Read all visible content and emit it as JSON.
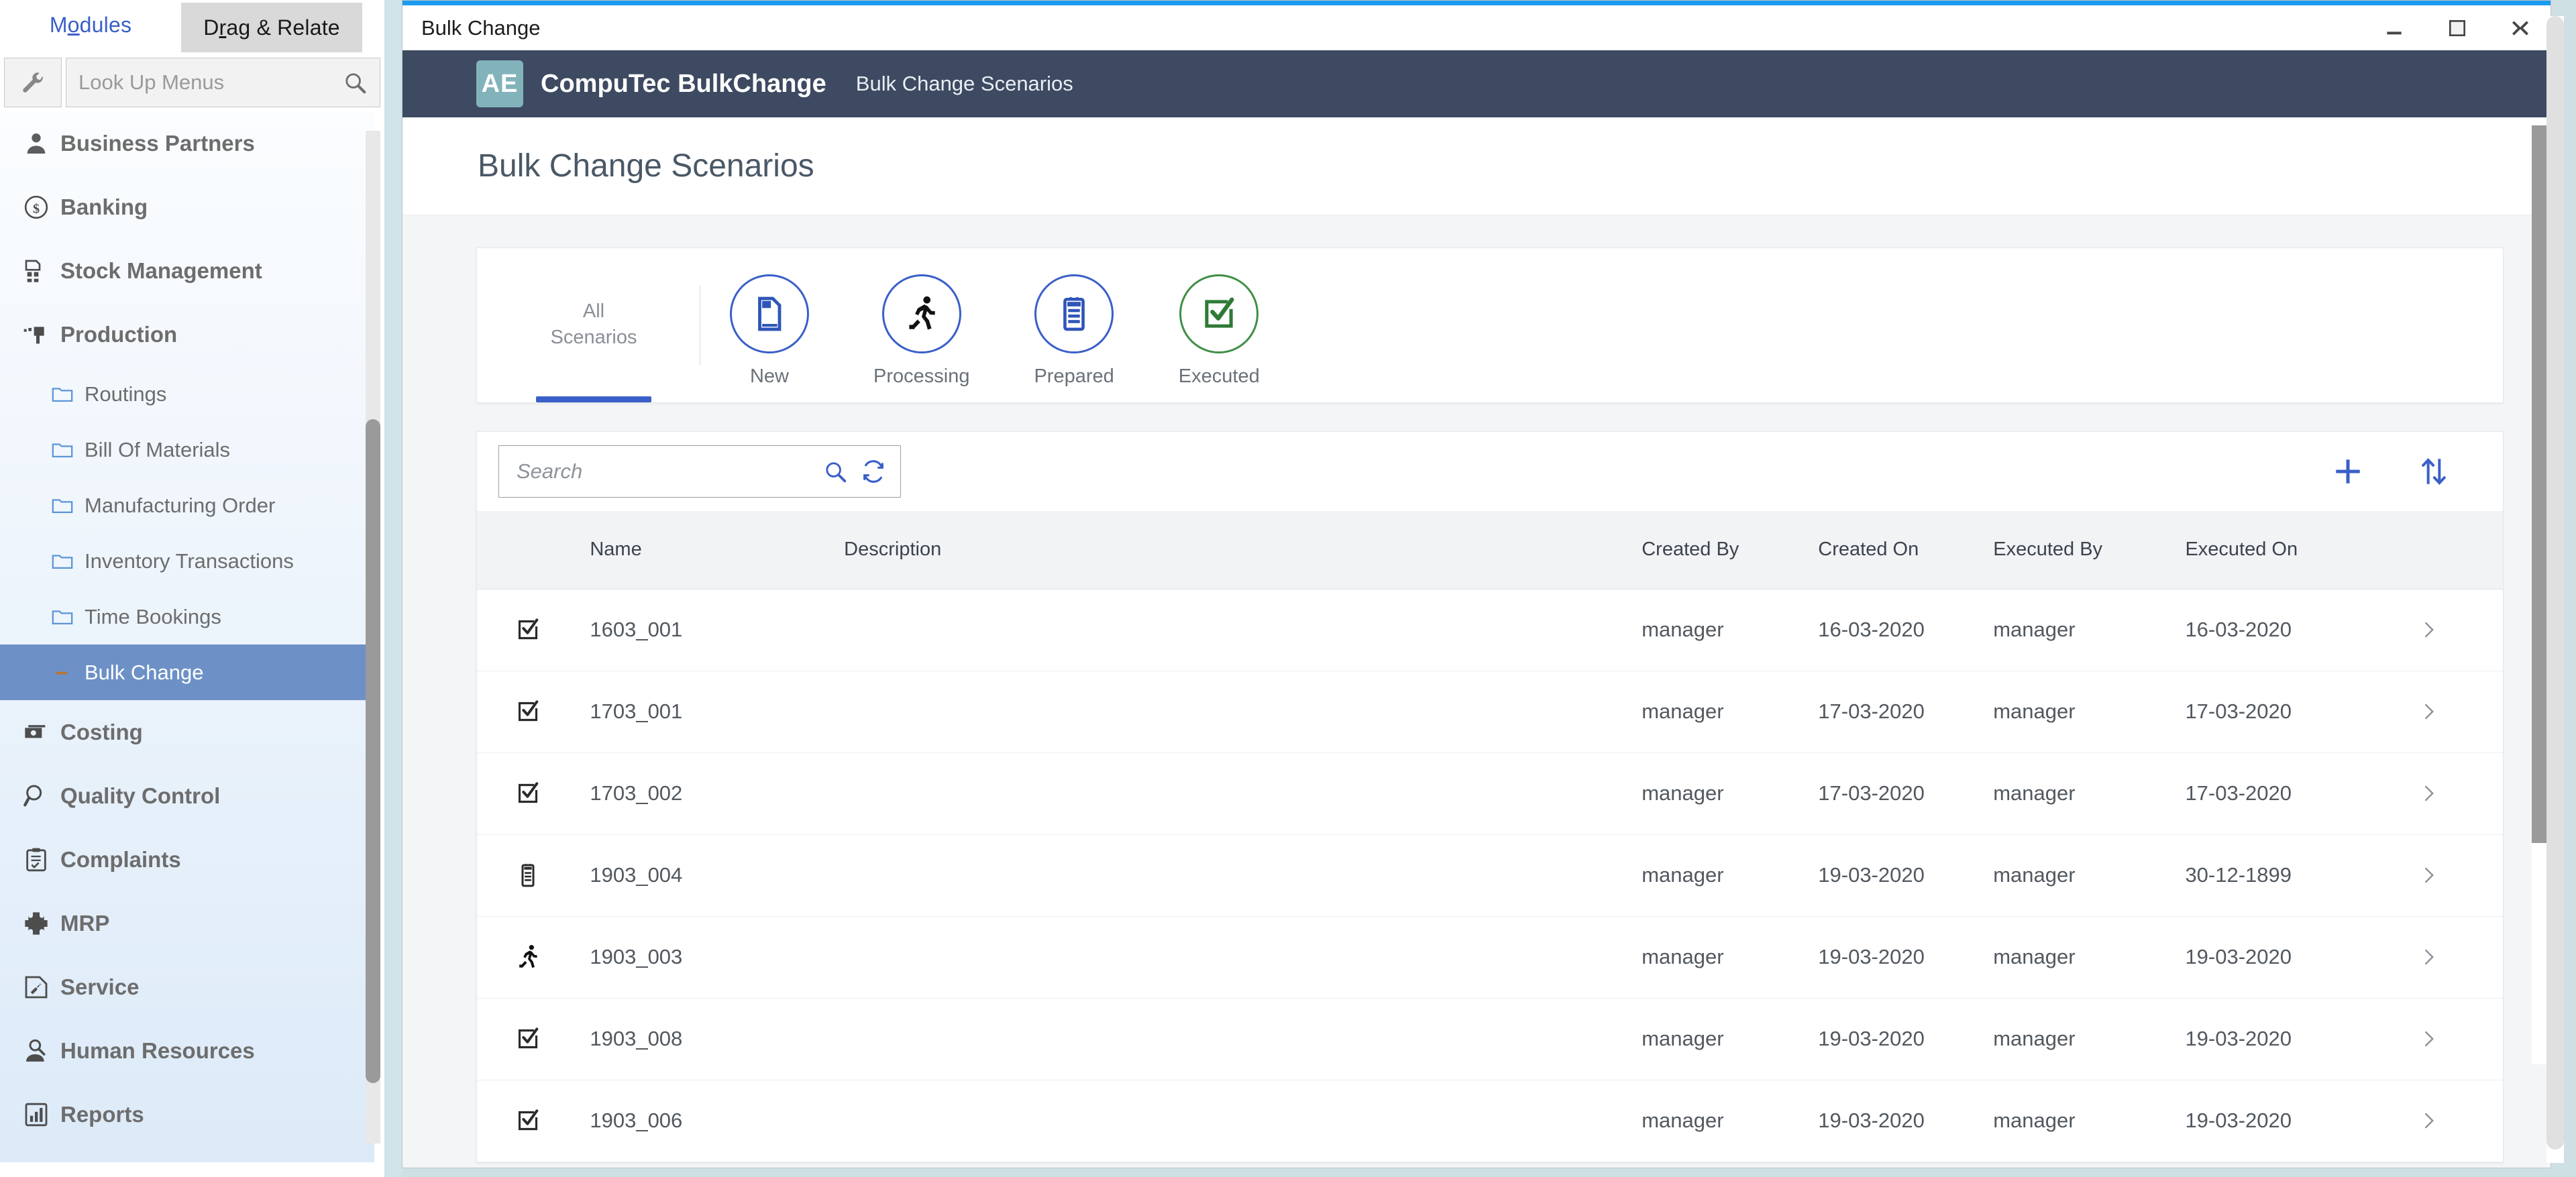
{
  "shell": {
    "tabs": [
      {
        "label": "Modules",
        "underline_char": "o",
        "active": true
      },
      {
        "label": "Drag & Relate",
        "underline_char": "r",
        "active": false
      }
    ],
    "lookup": {
      "placeholder": "Look Up Menus"
    },
    "nav": [
      {
        "label": "Business Partners",
        "icon": "person-icon",
        "level": "top"
      },
      {
        "label": "Banking",
        "icon": "dollar-circle-icon",
        "level": "top"
      },
      {
        "label": "Stock Management",
        "icon": "stock-icon",
        "level": "top"
      },
      {
        "label": "Production",
        "icon": "production-icon",
        "level": "top"
      },
      {
        "label": "Routings",
        "icon": "folder-icon",
        "level": "sub"
      },
      {
        "label": "Bill Of Materials",
        "icon": "folder-icon",
        "level": "sub"
      },
      {
        "label": "Manufacturing Order",
        "icon": "folder-icon",
        "level": "sub"
      },
      {
        "label": "Inventory Transactions",
        "icon": "folder-icon",
        "level": "sub"
      },
      {
        "label": "Time Bookings",
        "icon": "folder-icon",
        "level": "sub"
      },
      {
        "label": "Bulk Change",
        "icon": "dash-icon",
        "level": "sub",
        "active": true
      },
      {
        "label": "Costing",
        "icon": "money-icon",
        "level": "top"
      },
      {
        "label": "Quality Control",
        "icon": "magnifier-icon",
        "level": "top"
      },
      {
        "label": "Complaints",
        "icon": "clipboard-check-icon",
        "level": "top"
      },
      {
        "label": "MRP",
        "icon": "puzzle-icon",
        "level": "top"
      },
      {
        "label": "Service",
        "icon": "service-icon",
        "level": "top"
      },
      {
        "label": "Human Resources",
        "icon": "person-search-icon",
        "level": "top"
      },
      {
        "label": "Reports",
        "icon": "bar-chart-icon",
        "level": "top"
      }
    ]
  },
  "window": {
    "title": "Bulk Change",
    "minimize_label": "–",
    "maximize_label": "☐",
    "close_label": "✕"
  },
  "app": {
    "logo_text": "AE",
    "brand": "CompuTec BulkChange",
    "breadcrumb": "Bulk Change Scenarios",
    "page_title": "Bulk Change Scenarios"
  },
  "scenario_tabs": [
    {
      "label": "All",
      "label2": "Scenarios",
      "icon": "none",
      "active": true,
      "color": "#3a5fc8"
    },
    {
      "label": "New",
      "icon": "document-icon",
      "active": false,
      "color": "#3a5fc8"
    },
    {
      "label": "Processing",
      "icon": "running-person-icon",
      "active": false,
      "color": "#3a5fc8"
    },
    {
      "label": "Prepared",
      "icon": "clipboard-list-icon",
      "active": false,
      "color": "#3a5fc8"
    },
    {
      "label": "Executed",
      "icon": "check-box-icon",
      "active": false,
      "color": "#3f8f46"
    }
  ],
  "toolbar": {
    "search_placeholder": "Search",
    "search_value": "",
    "search_icon": "search-icon",
    "refresh_icon": "refresh-icon",
    "add_icon": "plus-icon",
    "sort_icon": "sort-arrows-icon"
  },
  "table": {
    "columns": [
      {
        "key": "status",
        "label": ""
      },
      {
        "key": "name",
        "label": "Name"
      },
      {
        "key": "description",
        "label": "Description"
      },
      {
        "key": "created_by",
        "label": "Created By"
      },
      {
        "key": "created_on",
        "label": "Created On"
      },
      {
        "key": "executed_by",
        "label": "Executed By"
      },
      {
        "key": "executed_on",
        "label": "Executed On"
      },
      {
        "key": "chevron",
        "label": ""
      }
    ],
    "rows": [
      {
        "status_icon": "check-box-icon",
        "name": "1603_001",
        "description": "",
        "created_by": "manager",
        "created_on": "16-03-2020",
        "executed_by": "manager",
        "executed_on": "16-03-2020"
      },
      {
        "status_icon": "check-box-icon",
        "name": "1703_001",
        "description": "",
        "created_by": "manager",
        "created_on": "17-03-2020",
        "executed_by": "manager",
        "executed_on": "17-03-2020"
      },
      {
        "status_icon": "check-box-icon",
        "name": "1703_002",
        "description": "",
        "created_by": "manager",
        "created_on": "17-03-2020",
        "executed_by": "manager",
        "executed_on": "17-03-2020"
      },
      {
        "status_icon": "clipboard-list-icon",
        "name": "1903_004",
        "description": "",
        "created_by": "manager",
        "created_on": "19-03-2020",
        "executed_by": "manager",
        "executed_on": "30-12-1899"
      },
      {
        "status_icon": "running-person-icon",
        "name": "1903_003",
        "description": "",
        "created_by": "manager",
        "created_on": "19-03-2020",
        "executed_by": "manager",
        "executed_on": "19-03-2020"
      },
      {
        "status_icon": "check-box-icon",
        "name": "1903_008",
        "description": "",
        "created_by": "manager",
        "created_on": "19-03-2020",
        "executed_by": "manager",
        "executed_on": "19-03-2020"
      },
      {
        "status_icon": "check-box-icon",
        "name": "1903_006",
        "description": "",
        "created_by": "manager",
        "created_on": "19-03-2020",
        "executed_by": "manager",
        "executed_on": "19-03-2020"
      }
    ]
  },
  "colors": {
    "header_bg": "#3d4a61",
    "logo_bg": "#82b3bb",
    "accent_blue": "#3a5fc8",
    "accent_green": "#3f8f46",
    "sidebar_active": "#6d91c6",
    "titlebar_accent": "#1b9bf0"
  }
}
